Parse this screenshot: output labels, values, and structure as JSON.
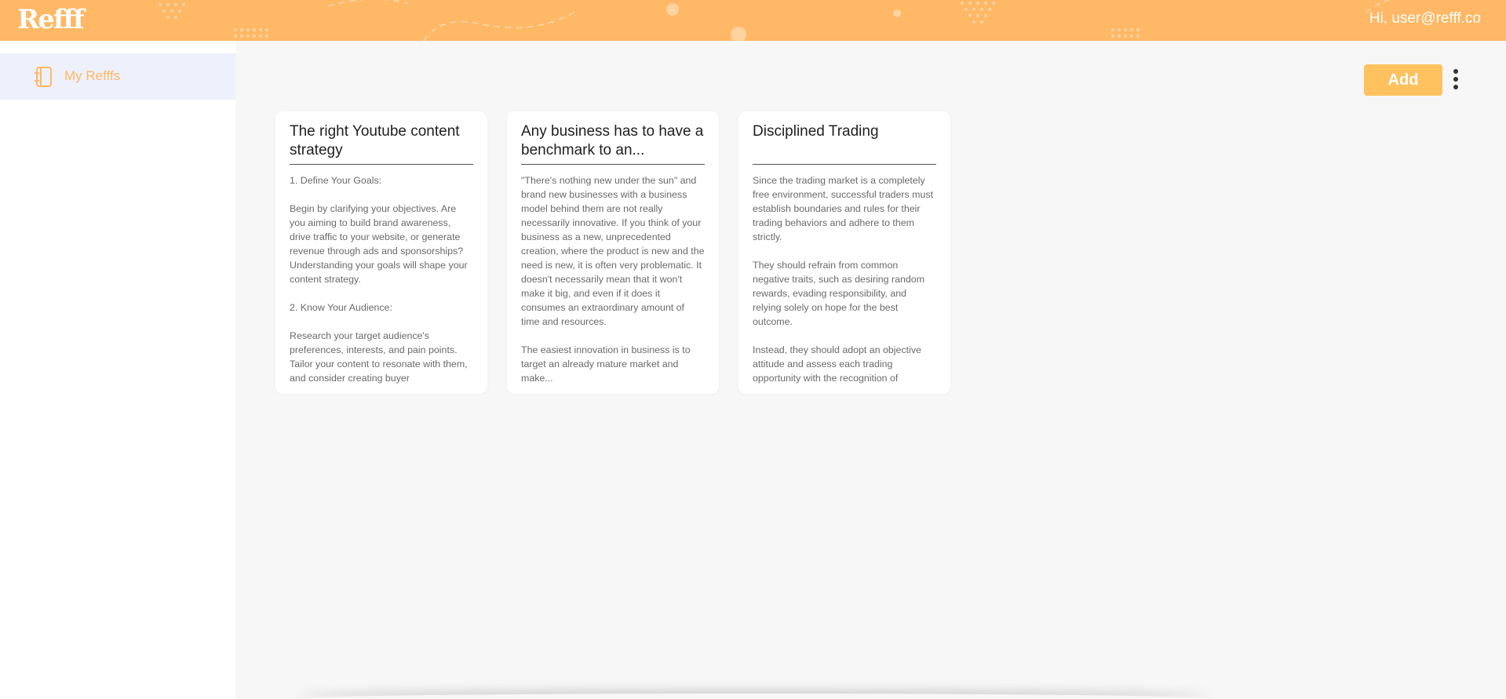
{
  "app": {
    "logo": "Refff"
  },
  "header": {
    "greeting": "Hi, user@refff.co"
  },
  "sidebar": {
    "items": [
      {
        "label": "My Refffs",
        "icon": "notebook-icon"
      }
    ]
  },
  "toolbar": {
    "add_label": "Add",
    "more_icon": "more-vertical-icon"
  },
  "cards": [
    {
      "title": "The right Youtube content strategy",
      "body": "1. Define Your Goals:\n\nBegin by clarifying your objectives. Are you aiming to build brand awareness, drive traffic to your website, or generate revenue through ads and sponsorships? Understanding your goals will shape your content strategy.\n\n2. Know Your Audience:\n\nResearch your target audience's preferences, interests, and pain points. Tailor your content to resonate with them, and consider creating buyer"
    },
    {
      "title": "Any business has to have a benchmark to an...",
      "body": "\"There's nothing new under the sun\" and brand new businesses with a business model behind them are not really necessarily innovative. If you think of your business as a new, unprecedented creation, where the product is new and the need is new, it is often very problematic. It doesn't necessarily mean that it won't make it big, and even if it does it consumes an extraordinary amount of time and resources.\n\nThe easiest innovation in business is to target an already mature market and make..."
    },
    {
      "title": "Disciplined Trading",
      "body": "Since the trading market is a completely free environment, successful traders must establish boundaries and rules for their trading behaviors and adhere to them strictly.\n\nThey should refrain from common negative traits, such as desiring random rewards, evading responsibility, and relying solely on hope for the best outcome.\n\nInstead, they should adopt an objective attitude and assess each trading opportunity with the recognition of"
    }
  ],
  "colors": {
    "brand": "#ffb865",
    "button": "#ffc25f",
    "nav_active_bg": "#eef0fb"
  }
}
